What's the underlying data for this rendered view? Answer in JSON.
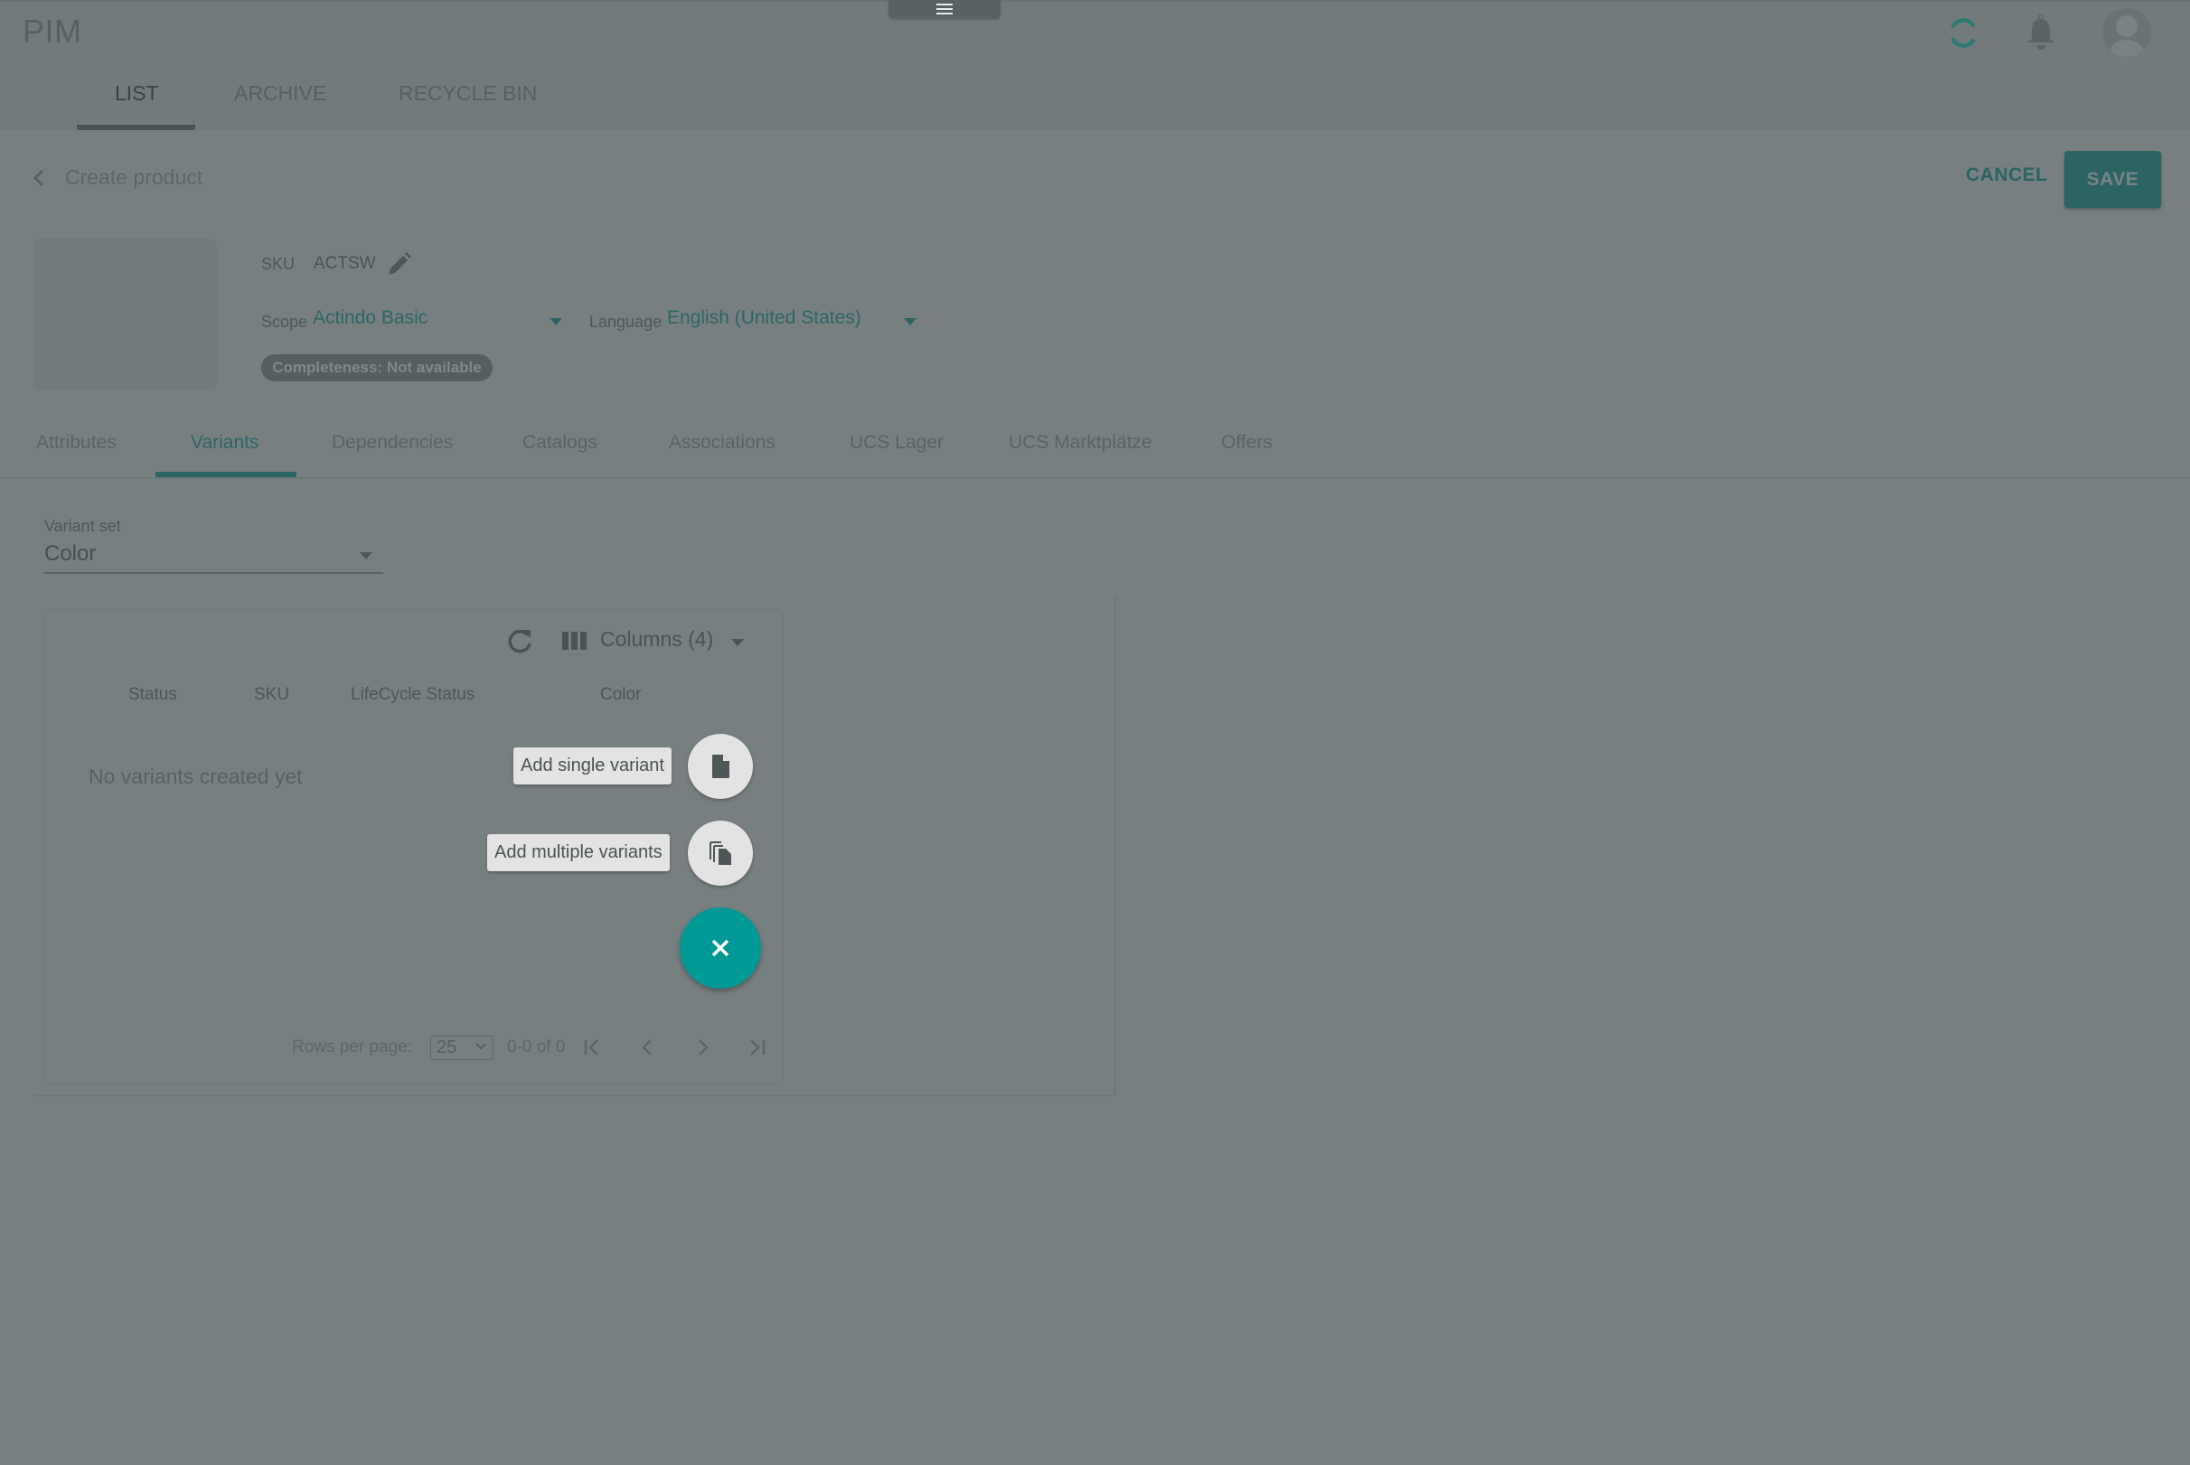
{
  "app": {
    "title": "PIM",
    "top_tabs": [
      {
        "label": "LIST",
        "active": true
      },
      {
        "label": "ARCHIVE",
        "active": false
      },
      {
        "label": "RECYCLE BIN",
        "active": false
      }
    ],
    "header_icons": [
      "sync-icon",
      "notifications-bell-icon",
      "user-avatar-icon"
    ]
  },
  "page": {
    "title": "Create product",
    "cancel_label": "CANCEL",
    "save_label": "SAVE"
  },
  "product": {
    "sku_label": "SKU",
    "sku_value": "ACTSW",
    "scope_label": "Scope",
    "scope_value": "Actindo Basic",
    "language_label": "Language",
    "language_value": "English (United States)",
    "completeness_badge": "Completeness: Not available"
  },
  "section_tabs": [
    {
      "label": "Attributes",
      "active": false
    },
    {
      "label": "Variants",
      "active": true
    },
    {
      "label": "Dependencies",
      "active": false
    },
    {
      "label": "Catalogs",
      "active": false
    },
    {
      "label": "Associations",
      "active": false
    },
    {
      "label": "UCS Lager",
      "active": false
    },
    {
      "label": "UCS Marktplätze",
      "active": false
    },
    {
      "label": "Offers",
      "active": false
    }
  ],
  "variants": {
    "variant_set_label": "Variant set",
    "variant_set_value": "Color",
    "columns_label": "Columns (4)",
    "columns": [
      "Status",
      "SKU",
      "LifeCycle Status",
      "Color"
    ],
    "empty_message": "No variants created yet",
    "speed_dial": {
      "add_single_label": "Add single variant",
      "add_multiple_label": "Add multiple variants"
    },
    "pagination": {
      "rows_per_page_label": "Rows per page:",
      "rows_per_page_value": "25",
      "range_text": "0-0 of 0"
    }
  },
  "colors": {
    "accent": "#2c6664",
    "fab": "#009996",
    "overlay_bg": "#787f80"
  }
}
